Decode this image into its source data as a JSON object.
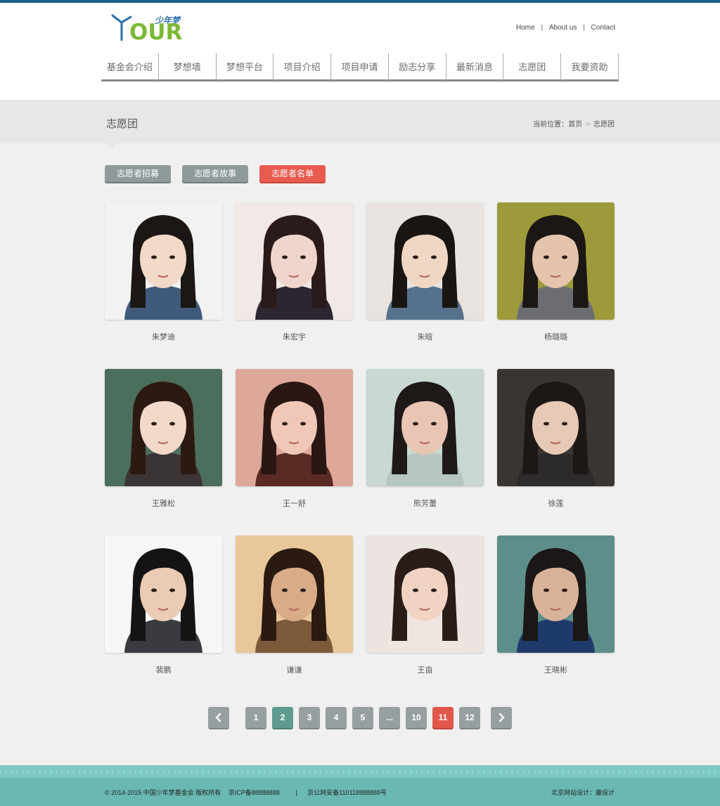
{
  "header": {
    "logo_cn": "少年梦",
    "logo_en": "OUR",
    "links": [
      "Home",
      "About us",
      "Contact"
    ],
    "link_separator": "|"
  },
  "nav": {
    "items": [
      "基金会介绍",
      "梦想墙",
      "梦想平台",
      "项目介绍",
      "项目申请",
      "励志分享",
      "最新消息",
      "志愿团",
      "我要资助"
    ]
  },
  "title": {
    "page": "志愿团",
    "breadcrumb_prefix": "当前位置：",
    "breadcrumb_home": "首页",
    "breadcrumb_arrow": ">",
    "breadcrumb_current": "志愿团"
  },
  "subtabs": [
    {
      "label": "志愿者招募",
      "active": false
    },
    {
      "label": "志愿者故事",
      "active": false
    },
    {
      "label": "志愿者名单",
      "active": true
    }
  ],
  "volunteers": [
    {
      "name": "朱梦迪",
      "bg": "#f2f2f2",
      "skin": "#f2d9c8",
      "hair": "#1c1714",
      "shirt": "#3f5a7a"
    },
    {
      "name": "朱宏宇",
      "bg": "#f1e9e6",
      "skin": "#efd5cb",
      "hair": "#2a1a1a",
      "shirt": "#2c2630"
    },
    {
      "name": "朱晗",
      "bg": "#e8e3df",
      "skin": "#f0d7c4",
      "hair": "#1b1512",
      "shirt": "#56718c"
    },
    {
      "name": "杨璐璐",
      "bg": "#9c9a3a",
      "skin": "#e4c4ac",
      "hair": "#1c1714",
      "shirt": "#6b6d73"
    },
    {
      "name": "王雅松",
      "bg": "#4c6e5c",
      "skin": "#f3d9c9",
      "hair": "#2c1a12",
      "shirt": "#3a3434"
    },
    {
      "name": "王一舒",
      "bg": "#dda89a",
      "skin": "#f1c8b7",
      "hair": "#2a1714",
      "shirt": "#5a2a24"
    },
    {
      "name": "熊芳蕾",
      "bg": "#c9d8d0",
      "skin": "#e9c5b4",
      "hair": "#1e1917",
      "shirt": "#b7c7c0"
    },
    {
      "name": "徐莲",
      "bg": "#3b3532",
      "skin": "#e6cab6",
      "hair": "#1d1816",
      "shirt": "#2d2a2a"
    },
    {
      "name": "裴鹏",
      "bg": "#f6f6f6",
      "skin": "#eacbb3",
      "hair": "#151313",
      "shirt": "#3a3b40"
    },
    {
      "name": "谦谦",
      "bg": "#e8c79a",
      "skin": "#d9ab87",
      "hair": "#2a1a10",
      "shirt": "#7b5a3a"
    },
    {
      "name": "王亩",
      "bg": "#ebe4e0",
      "skin": "#f0d3c2",
      "hair": "#2a1d18",
      "shirt": "#f0e6e0"
    },
    {
      "name": "王晓彬",
      "bg": "#5e8e8a",
      "skin": "#d8b299",
      "hair": "#1a1716",
      "shirt": "#1e3a6a"
    }
  ],
  "pagination": {
    "prev_icon": "chevron-left-icon",
    "next_icon": "chevron-right-icon",
    "pages": [
      "1",
      "2",
      "3",
      "4",
      "5",
      "...",
      "10",
      "11",
      "12"
    ],
    "current_page": "2",
    "highlight_page": "11"
  },
  "footer": {
    "copyright": "© 2014-2015  中国少年梦基金会  版权所有",
    "icp": "京ICP备88888888",
    "separator": "|",
    "police": "京公网安备110118888888号",
    "design": "北京网站设计：藤设计"
  },
  "colors": {
    "accent_red": "#e2574c",
    "current_teal": "#5f9b8e",
    "footer_teal": "#6ab8b2",
    "top_bar": "#1d5e86",
    "logo_green": "#7cb934"
  }
}
